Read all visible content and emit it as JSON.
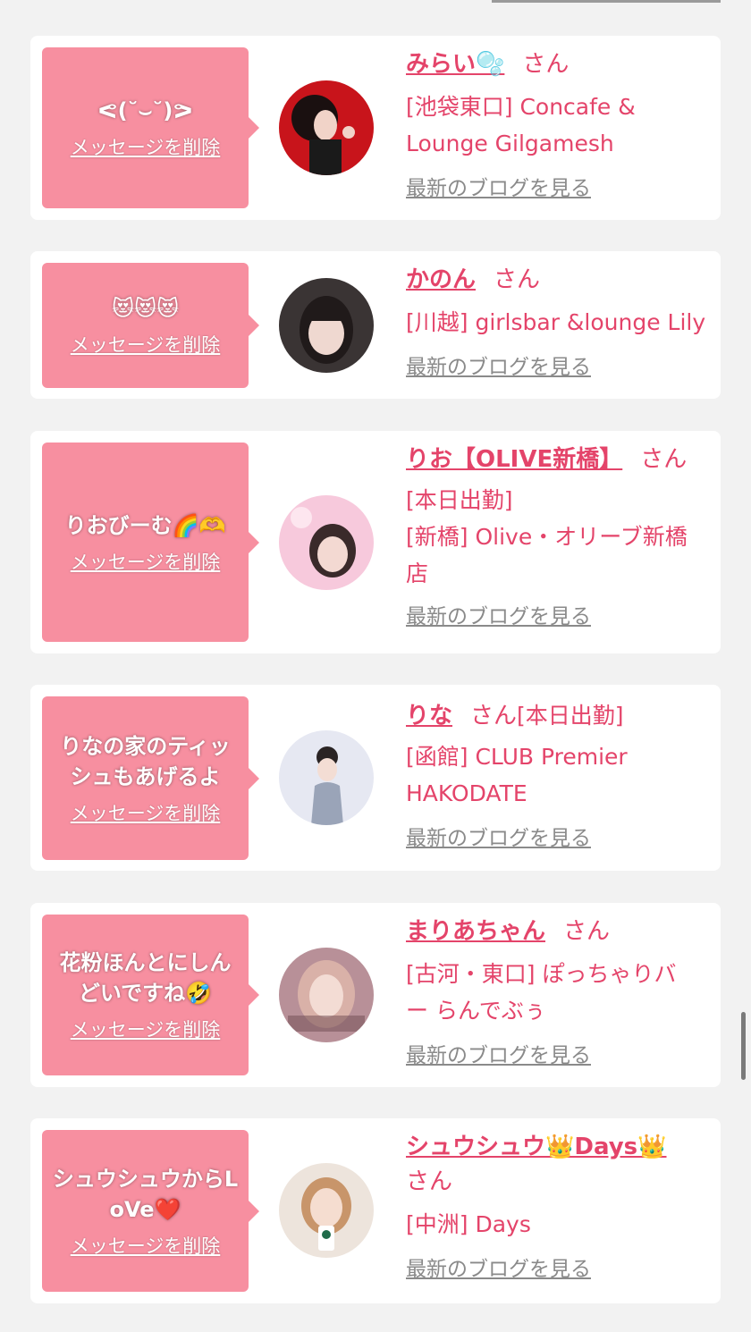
{
  "delete_label": "メッセージを削除",
  "blog_label": "最新のブログを見る",
  "san_label": "さん",
  "colors": {
    "accent": "#e4446a",
    "bubble": "#f78fa0",
    "link_gray": "#8a8a8a"
  },
  "cards": [
    {
      "message": "ᕙ(˘⌣˘)ᕗ",
      "name": "みらい🫧",
      "lines": [
        "[池袋東口] Concafe &",
        "Lounge Gilgamesh"
      ]
    },
    {
      "message": "😻😻😻",
      "name": "かのん",
      "lines": [
        "[川越] girlsbar &lounge Lily"
      ]
    },
    {
      "message": "りおびーむ🌈🫶",
      "name": "りお【OLIVE新橋】",
      "lines": [
        "[本日出勤]",
        "[新橋] Olive・オリーブ新橋",
        "店"
      ]
    },
    {
      "message": "りなの家のティッシュもあげるよ",
      "name": "りな",
      "san_suffix": "[本日出勤]",
      "lines": [
        "[函館] CLUB Premier",
        "HAKODATE"
      ]
    },
    {
      "message": "花粉ほんとにしんどいですね🤣",
      "name": "まりあちゃん",
      "lines": [
        "[古河・東口] ぽっちゃりバ",
        "ー らんでぶぅ"
      ]
    },
    {
      "message": "シュウシュウからLoVe❤️",
      "name": "シュウシュウ👑Days👑",
      "san_newline": true,
      "lines": [
        "[中洲] Days"
      ]
    }
  ]
}
